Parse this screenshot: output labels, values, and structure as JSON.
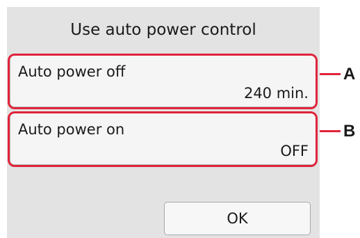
{
  "screen": {
    "title": "Use auto power control",
    "settings": [
      {
        "label": "Auto power off",
        "value": "240 min."
      },
      {
        "label": "Auto power on",
        "value": "OFF"
      }
    ],
    "ok_label": "OK"
  },
  "callouts": {
    "a": "A",
    "b": "B"
  },
  "colors": {
    "highlight": "#e0243b",
    "screen_background": "#e3e3e3",
    "row_background": "#f5f5f5"
  }
}
